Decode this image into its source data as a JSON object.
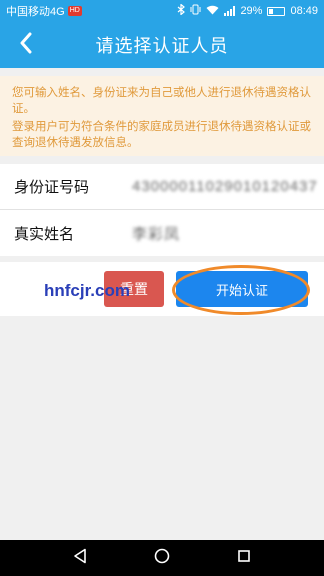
{
  "status_bar": {
    "carrier": "中国移动4G",
    "hd_badge": "HD",
    "battery": "29%",
    "time": "08:49"
  },
  "nav": {
    "title": "请选择认证人员",
    "back_icon": "chevron-left-icon"
  },
  "notice": {
    "line1": "您可输入姓名、身份证来为自己或他人进行退休待遇资格认证。",
    "line2": "登录用户可为符合条件的家庭成员进行退休待遇资格认证或查询退休待遇发放信息。"
  },
  "form": {
    "id_label": "身份证号码",
    "id_value": "43000011029010120437",
    "name_label": "真实姓名",
    "name_value": "李彩凤"
  },
  "buttons": {
    "reset": "重置",
    "start": "开始认证"
  },
  "watermark": "hnfcjr.com",
  "colors": {
    "primary_blue": "#29a4e6",
    "start_button": "#1c86ee",
    "reset_button": "#d95750",
    "notice_text": "#e09a3c",
    "notice_bg": "#fcf2e3",
    "highlight": "#f08a2a"
  }
}
